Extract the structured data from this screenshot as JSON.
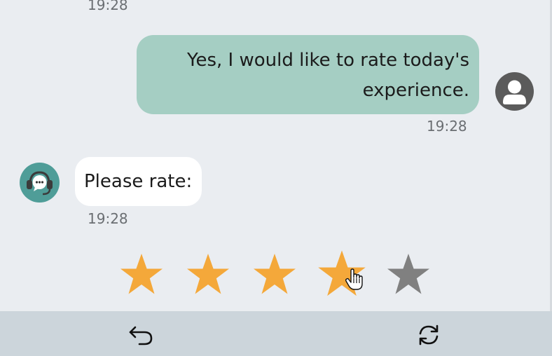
{
  "colors": {
    "background": "#eaedf1",
    "user_bubble": "#a5cec3",
    "bot_bubble": "#ffffff",
    "star_filled": "#f4a83a",
    "star_empty": "#808080",
    "footer": "#ccd5db"
  },
  "messages": {
    "top_timestamp": "19:28",
    "user": {
      "line1": "Yes, I would like to rate today's",
      "line2": "experience.",
      "timestamp": "19:28",
      "avatar_icon": "user-icon"
    },
    "bot": {
      "text": "Please rate:",
      "timestamp": "19:28",
      "avatar_icon": "support-agent-icon"
    }
  },
  "rating": {
    "max_stars": 5,
    "hovered_value": 4,
    "star_icon": "star-icon",
    "cursor_icon": "hand-pointer-icon"
  },
  "footer": {
    "back_icon": "back-arrow-icon",
    "refresh_icon": "refresh-icon"
  }
}
